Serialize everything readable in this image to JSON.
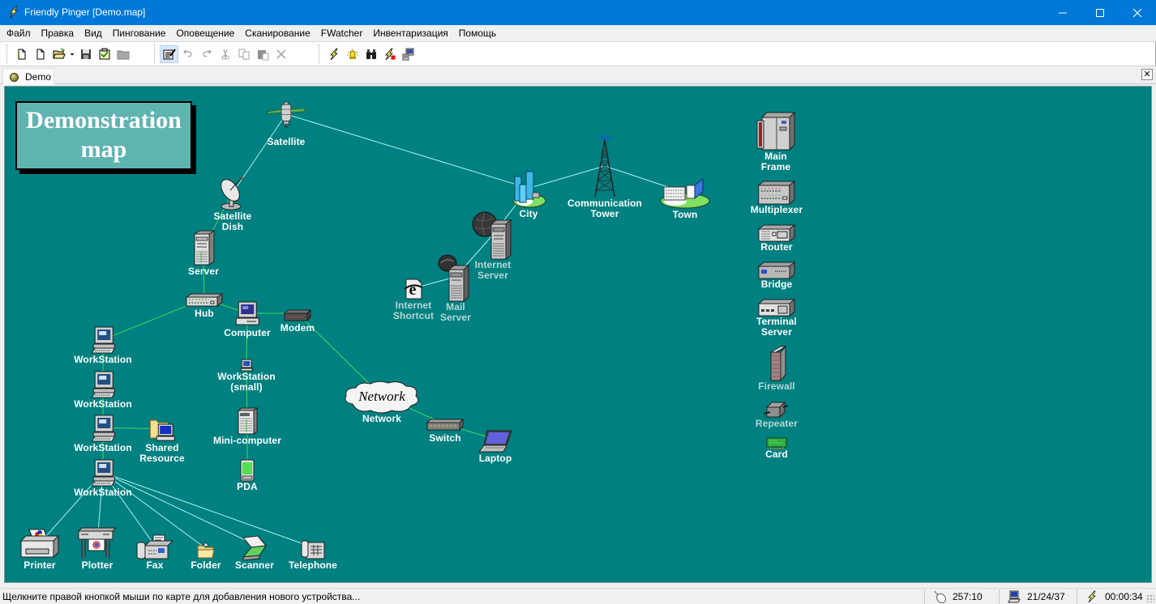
{
  "window": {
    "title": "Friendly Pinger [Demo.map]",
    "controls": {
      "minimize": "minimize",
      "maximize": "maximize",
      "close": "close"
    }
  },
  "menu": [
    "Файл",
    "Правка",
    "Вид",
    "Пингование",
    "Оповещение",
    "Сканирование",
    "FWatcher",
    "Инвентаризация",
    "Помощь"
  ],
  "toolbar": {
    "groups": [
      [
        "new-map-wizard",
        "new-map",
        "open-map",
        "open-dropdown",
        "save-map",
        "check-map",
        "folder"
      ],
      [
        "edit-mode",
        "undo",
        "redo",
        "cut",
        "copy",
        "paste",
        "delete"
      ],
      [
        "ping-now",
        "alarm",
        "find",
        "stop-ping",
        "inventory"
      ]
    ],
    "active": "edit-mode"
  },
  "tabs": [
    {
      "label": "Demo",
      "status": "olive"
    }
  ],
  "map": {
    "background": "#008080",
    "banner": {
      "line1": "Demonstration",
      "line2": "map"
    },
    "link_colors": {
      "lan": "#3fdc5a",
      "wan": "#a8f4f4"
    },
    "nodes": [
      {
        "id": "satellite",
        "label": "Satellite",
        "icon": "satellite-icon",
        "up": true
      },
      {
        "id": "dish",
        "label": "Satellite\nDish",
        "icon": "satellite-dish-icon",
        "up": true
      },
      {
        "id": "server",
        "label": "Server",
        "icon": "server-icon",
        "up": true
      },
      {
        "id": "hub",
        "label": "Hub",
        "icon": "hub-icon",
        "up": true
      },
      {
        "id": "computer",
        "label": "Computer",
        "icon": "computer-icon",
        "up": true
      },
      {
        "id": "modem",
        "label": "Modem",
        "icon": "modem-icon",
        "up": true
      },
      {
        "id": "ws1",
        "label": "WorkStation",
        "icon": "workstation-icon",
        "up": true
      },
      {
        "id": "ws2",
        "label": "WorkStation",
        "icon": "workstation-icon",
        "up": true
      },
      {
        "id": "ws3",
        "label": "WorkStation",
        "icon": "workstation-icon",
        "up": true
      },
      {
        "id": "ws4",
        "label": "WorkStation",
        "icon": "workstation-icon",
        "up": true
      },
      {
        "id": "shared",
        "label": "Shared\nResource",
        "icon": "shared-resource-icon",
        "up": true
      },
      {
        "id": "wssmall",
        "label": "WorkStation\n(small)",
        "icon": "workstation-small-icon",
        "up": true
      },
      {
        "id": "mini",
        "label": "Mini-computer",
        "icon": "mini-computer-icon",
        "up": true
      },
      {
        "id": "pda",
        "label": "PDA",
        "icon": "pda-icon",
        "up": true
      },
      {
        "id": "printer",
        "label": "Printer",
        "icon": "printer-icon",
        "up": true
      },
      {
        "id": "plotter",
        "label": "Plotter",
        "icon": "plotter-icon",
        "up": true
      },
      {
        "id": "fax",
        "label": "Fax",
        "icon": "fax-icon",
        "up": true
      },
      {
        "id": "folder",
        "label": "Folder",
        "icon": "folder-icon",
        "up": true
      },
      {
        "id": "scanner",
        "label": "Scanner",
        "icon": "scanner-icon",
        "up": true
      },
      {
        "id": "telephone",
        "label": "Telephone",
        "icon": "telephone-icon",
        "up": true
      },
      {
        "id": "network",
        "label": "Network",
        "icon": "network-cloud-icon",
        "cloud_text": "Network",
        "up": true
      },
      {
        "id": "switch",
        "label": "Switch",
        "icon": "switch-icon",
        "up": true
      },
      {
        "id": "laptop",
        "label": "Laptop",
        "icon": "laptop-icon",
        "up": true
      },
      {
        "id": "city",
        "label": "City",
        "icon": "city-icon",
        "up": true
      },
      {
        "id": "tower",
        "label": "Communication\nTower",
        "icon": "communication-tower-icon",
        "up": true
      },
      {
        "id": "town",
        "label": "Town",
        "icon": "town-icon",
        "up": true
      },
      {
        "id": "inetserver",
        "label": "Internet\nServer",
        "icon": "internet-server-icon",
        "up": false
      },
      {
        "id": "mailserver",
        "label": "Mail\nServer",
        "icon": "mail-server-icon",
        "up": false
      },
      {
        "id": "shortcut",
        "label": "Internet\nShortcut",
        "icon": "internet-shortcut-icon",
        "up": false
      },
      {
        "id": "mainframe",
        "label": "Main\nFrame",
        "icon": "mainframe-icon",
        "up": true
      },
      {
        "id": "mux",
        "label": "Multiplexer",
        "icon": "multiplexer-icon",
        "up": true
      },
      {
        "id": "router",
        "label": "Router",
        "icon": "router-icon",
        "up": true
      },
      {
        "id": "bridge",
        "label": "Bridge",
        "icon": "bridge-icon",
        "up": true
      },
      {
        "id": "termserver",
        "label": "Terminal\nServer",
        "icon": "terminal-server-icon",
        "up": true
      },
      {
        "id": "firewall",
        "label": "Firewall",
        "icon": "firewall-icon",
        "up": false
      },
      {
        "id": "repeater",
        "label": "Repeater",
        "icon": "repeater-icon",
        "up": false
      },
      {
        "id": "card",
        "label": "Card",
        "icon": "network-card-icon",
        "up": true
      }
    ],
    "links": [
      {
        "from": "satellite",
        "to": "dish",
        "type": "wan"
      },
      {
        "from": "satellite",
        "to": "city",
        "type": "wan"
      },
      {
        "from": "city",
        "to": "tower",
        "type": "wan"
      },
      {
        "from": "tower",
        "to": "town",
        "type": "wan"
      },
      {
        "from": "city",
        "to": "inetserver",
        "type": "wan"
      },
      {
        "from": "inetserver",
        "to": "mailserver",
        "type": "wan"
      },
      {
        "from": "mailserver",
        "to": "shortcut",
        "type": "wan"
      },
      {
        "from": "dish",
        "to": "server",
        "type": "lan"
      },
      {
        "from": "server",
        "to": "hub",
        "type": "lan"
      },
      {
        "from": "hub",
        "to": "ws1",
        "type": "lan"
      },
      {
        "from": "hub",
        "to": "computer",
        "type": "lan"
      },
      {
        "from": "computer",
        "to": "modem",
        "type": "lan"
      },
      {
        "from": "modem",
        "to": "network",
        "type": "lan"
      },
      {
        "from": "network",
        "to": "switch",
        "type": "lan"
      },
      {
        "from": "switch",
        "to": "laptop",
        "type": "lan"
      },
      {
        "from": "computer",
        "to": "wssmall",
        "type": "lan"
      },
      {
        "from": "wssmall",
        "to": "mini",
        "type": "lan"
      },
      {
        "from": "mini",
        "to": "pda",
        "type": "lan"
      },
      {
        "from": "ws1",
        "to": "ws2",
        "type": "lan"
      },
      {
        "from": "ws2",
        "to": "ws3",
        "type": "lan"
      },
      {
        "from": "ws3",
        "to": "shared",
        "type": "lan"
      },
      {
        "from": "ws3",
        "to": "ws4",
        "type": "lan"
      },
      {
        "from": "ws4",
        "to": "printer",
        "type": "wan"
      },
      {
        "from": "ws4",
        "to": "plotter",
        "type": "wan"
      },
      {
        "from": "ws4",
        "to": "fax",
        "type": "wan"
      },
      {
        "from": "ws4",
        "to": "folder",
        "type": "wan"
      },
      {
        "from": "ws4",
        "to": "scanner",
        "type": "wan"
      },
      {
        "from": "ws4",
        "to": "telephone",
        "type": "wan"
      }
    ]
  },
  "statusbar": {
    "hint": "Щелкните правой кнопкой мыши по карте для добавления нового устройства...",
    "mouse_coords": "257:10",
    "device_counts": "21/24/37",
    "timer": "00:00:34"
  }
}
